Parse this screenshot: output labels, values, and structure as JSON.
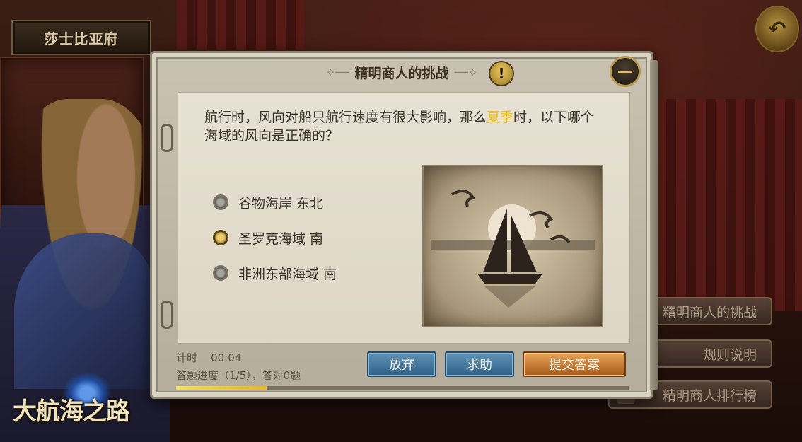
{
  "location": {
    "title": "莎士比亚府"
  },
  "dialog": {
    "title": "精明商人的挑战",
    "question": {
      "before": "航行时，风向对船只航行速度有很大影响，那么",
      "highlight": "夏季",
      "after": "时，以下哪个海域的风向是正确的？"
    },
    "options": [
      {
        "label": "谷物海岸  东北",
        "selected": false
      },
      {
        "label": "圣罗克海域  南",
        "selected": true
      },
      {
        "label": "非洲东部海域  南",
        "selected": false
      }
    ],
    "timer_label": "计时",
    "timer_value": "00:04",
    "progress_text": "答题进度（1/5），答对0题",
    "progress_fraction": 0.2,
    "buttons": {
      "abandon": "放弃",
      "help": "求助",
      "submit": "提交答案"
    }
  },
  "side_menu": [
    "精明商人的挑战",
    "规则说明",
    "精明商人排行榜"
  ],
  "logo_text": "大航海之路",
  "colors": {
    "highlight": "#f2c10e",
    "button_blue": "#2f6186",
    "button_orange": "#a85a1a"
  }
}
